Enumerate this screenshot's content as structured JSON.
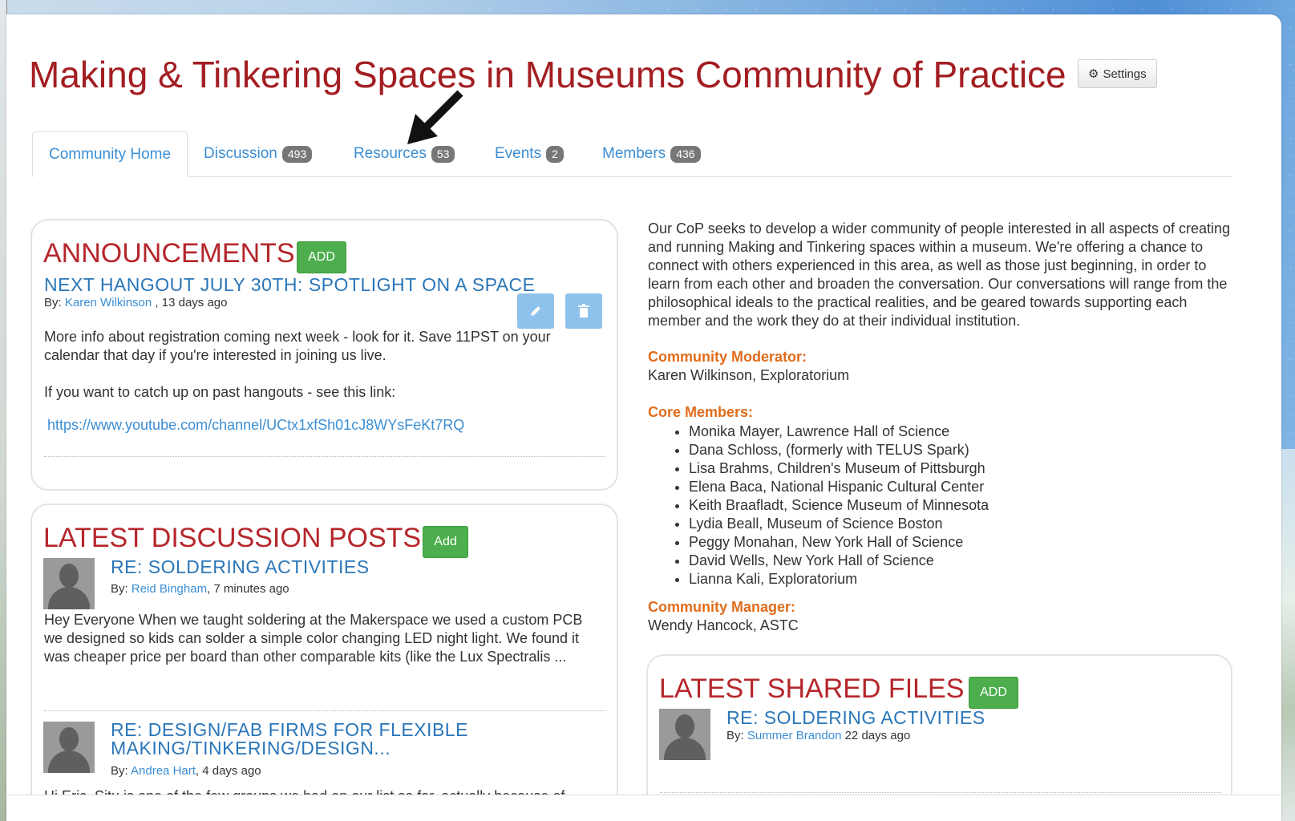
{
  "page": {
    "title": "Making & Tinkering Spaces in Museums Community of Practice",
    "settings_label": "Settings"
  },
  "tabs": [
    {
      "label": "Community Home",
      "count": ""
    },
    {
      "label": "Discussion",
      "count": "493"
    },
    {
      "label": "Resources",
      "count": "53"
    },
    {
      "label": "Events",
      "count": "2"
    },
    {
      "label": "Members",
      "count": "436"
    }
  ],
  "announcements": {
    "title": "ANNOUNCEMENTS",
    "add_label": "ADD",
    "post": {
      "title": "NEXT HANGOUT JULY 30TH: SPOTLIGHT ON A SPACE",
      "by_prefix": "By:",
      "author": "Karen Wilkinson",
      "time": " , 13 days ago",
      "para1": "More info about registration coming next week - look for it. Save 11PST on your calendar that day if you're interested in joining us live.",
      "para2": "If you want to catch up on past hangouts - see this link:",
      "link": "https://www.youtube.com/channel/UCtx1xfSh01cJ8WYsFeKt7RQ"
    }
  },
  "discussion": {
    "title": "LATEST DISCUSSION POSTS",
    "add_label": "Add",
    "posts": [
      {
        "title": "RE: SOLDERING ACTIVITIES",
        "by_prefix": "By:",
        "author": "Reid Bingham",
        "time": ", 7 minutes ago",
        "excerpt": "Hey Everyone When we taught soldering at the Makerspace we used a custom PCB we designed so kids can solder a simple color changing LED night light. We found it was cheaper price per board than other comparable kits (like the Lux Spectralis ..."
      },
      {
        "title_line1": "RE: DESIGN/FAB FIRMS FOR FLEXIBLE",
        "title_line2": "MAKING/TINKERING/DESIGN...",
        "by_prefix": "By:",
        "author": "Andrea Hart",
        "time": ", 4 days ago",
        "excerpt": "Hi Eric, Situ is one of the few groups we had on our list so far, actually because of"
      }
    ]
  },
  "about": {
    "description": "Our CoP seeks to develop a wider community of people interested in all aspects of creating and running Making and Tinkering spaces within a museum. We're offering a chance to connect with others experienced in this area, as well as those just beginning, in order to learn from each other and broaden the conversation. Our conversations will range from the philosophical ideals to the practical realities, and be geared towards supporting each member and the work they do at their individual institution.",
    "moderator_label": "Community Moderator:",
    "moderator": "Karen Wilkinson, Exploratorium",
    "core_label": "Core Members:",
    "core_members": [
      "Monika Mayer, Lawrence Hall of Science",
      "Dana Schloss, (formerly with TELUS Spark)",
      "Lisa Brahms, Children's Museum of Pittsburgh",
      "Elena Baca, National Hispanic Cultural Center",
      "Keith Braafladt, Science Museum of Minnesota",
      "Lydia Beall, Museum of Science Boston",
      "Peggy Monahan, New York Hall of Science",
      "David Wells, New York Hall of Science",
      "Lianna Kali, Exploratorium"
    ],
    "manager_label": "Community Manager:",
    "manager": "Wendy Hancock, ASTC"
  },
  "files": {
    "title": "LATEST SHARED FILES",
    "add_label": "ADD",
    "post": {
      "title": "RE: SOLDERING ACTIVITIES",
      "by_prefix": "By:",
      "author": "Summer Brandon",
      "time": " 22 days ago"
    }
  },
  "colors": {
    "title_red": "#a31e22",
    "link_blue": "#3b8ed4",
    "add_green": "#4cae4c",
    "label_orange": "#e06c1b"
  }
}
